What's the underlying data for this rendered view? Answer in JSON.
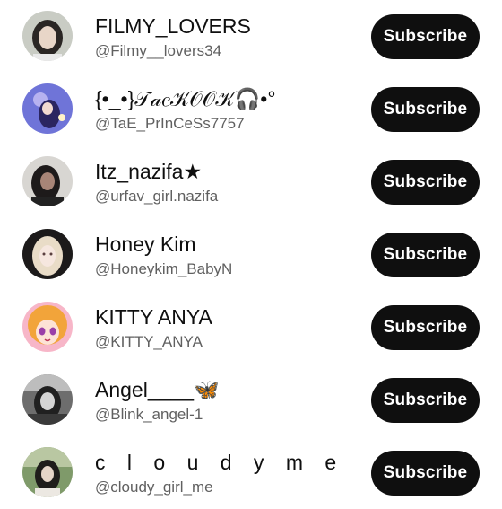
{
  "subscribe_label": "Subscribe",
  "channels": [
    {
      "name": "FILMY_LOVERS",
      "handle": "@Filmy__lovers34",
      "avatar_icon": "profile-photo"
    },
    {
      "name": "{•_•}𝒯𝒶𝑒𝒦𝒪𝒪𝒦🎧•°",
      "handle": "@TaE_PrInCeSs7757",
      "avatar_icon": "profile-photo"
    },
    {
      "name": "Itz_nazifa★",
      "handle": "@urfav_girl.nazifa",
      "avatar_icon": "profile-photo"
    },
    {
      "name": "Honey Kim",
      "handle": "@Honeykim_BabyN",
      "avatar_icon": "profile-photo"
    },
    {
      "name": "KITTY ANYA",
      "handle": "@KITTY_ANYA",
      "avatar_icon": "profile-photo"
    },
    {
      "name": "Angel____🦋",
      "handle": "@Blink_angel-1",
      "avatar_icon": "profile-photo"
    },
    {
      "name": "c l o u d y m e",
      "handle": "@cloudy_girl_me",
      "avatar_icon": "profile-photo"
    }
  ],
  "colors": {
    "button_bg": "#0f0f0f",
    "button_text": "#ffffff",
    "name_text": "#0f0f0f",
    "handle_text": "#606060"
  }
}
